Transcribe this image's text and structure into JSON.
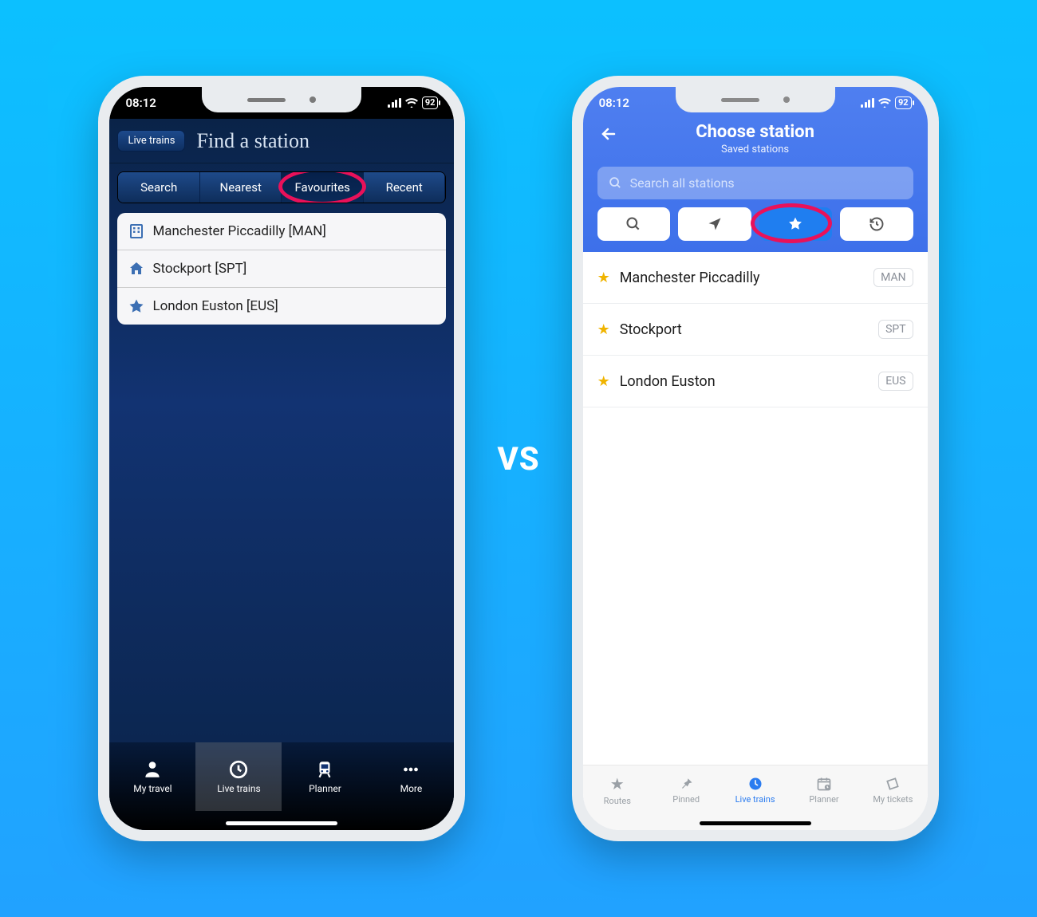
{
  "vs_label": "VS",
  "status": {
    "time": "08:12",
    "battery": "92"
  },
  "phone1": {
    "back_label": "Live trains",
    "title": "Find a station",
    "tabs": [
      "Search",
      "Nearest",
      "Favourites",
      "Recent"
    ],
    "active_tab_index": 2,
    "rows": [
      {
        "icon": "building",
        "label": "Manchester Piccadilly [MAN]"
      },
      {
        "icon": "home",
        "label": "Stockport [SPT]"
      },
      {
        "icon": "star",
        "label": "London Euston [EUS]"
      }
    ],
    "bottom_tabs": [
      {
        "icon": "person",
        "label": "My travel"
      },
      {
        "icon": "clock",
        "label": "Live trains"
      },
      {
        "icon": "train",
        "label": "Planner"
      },
      {
        "icon": "more",
        "label": "More"
      }
    ],
    "active_bottom_index": 1
  },
  "phone2": {
    "title": "Choose station",
    "subtitle": "Saved stations",
    "search_placeholder": "Search all stations",
    "mode_icons": [
      "search",
      "location",
      "star",
      "history"
    ],
    "active_mode_index": 2,
    "rows": [
      {
        "name": "Manchester Piccadilly",
        "code": "MAN"
      },
      {
        "name": "Stockport",
        "code": "SPT"
      },
      {
        "name": "London Euston",
        "code": "EUS"
      }
    ],
    "bottom_tabs": [
      {
        "icon": "star",
        "label": "Routes"
      },
      {
        "icon": "pin",
        "label": "Pinned"
      },
      {
        "icon": "clock",
        "label": "Live trains"
      },
      {
        "icon": "calendar",
        "label": "Planner"
      },
      {
        "icon": "ticket",
        "label": "My tickets"
      }
    ],
    "active_bottom_index": 2
  }
}
